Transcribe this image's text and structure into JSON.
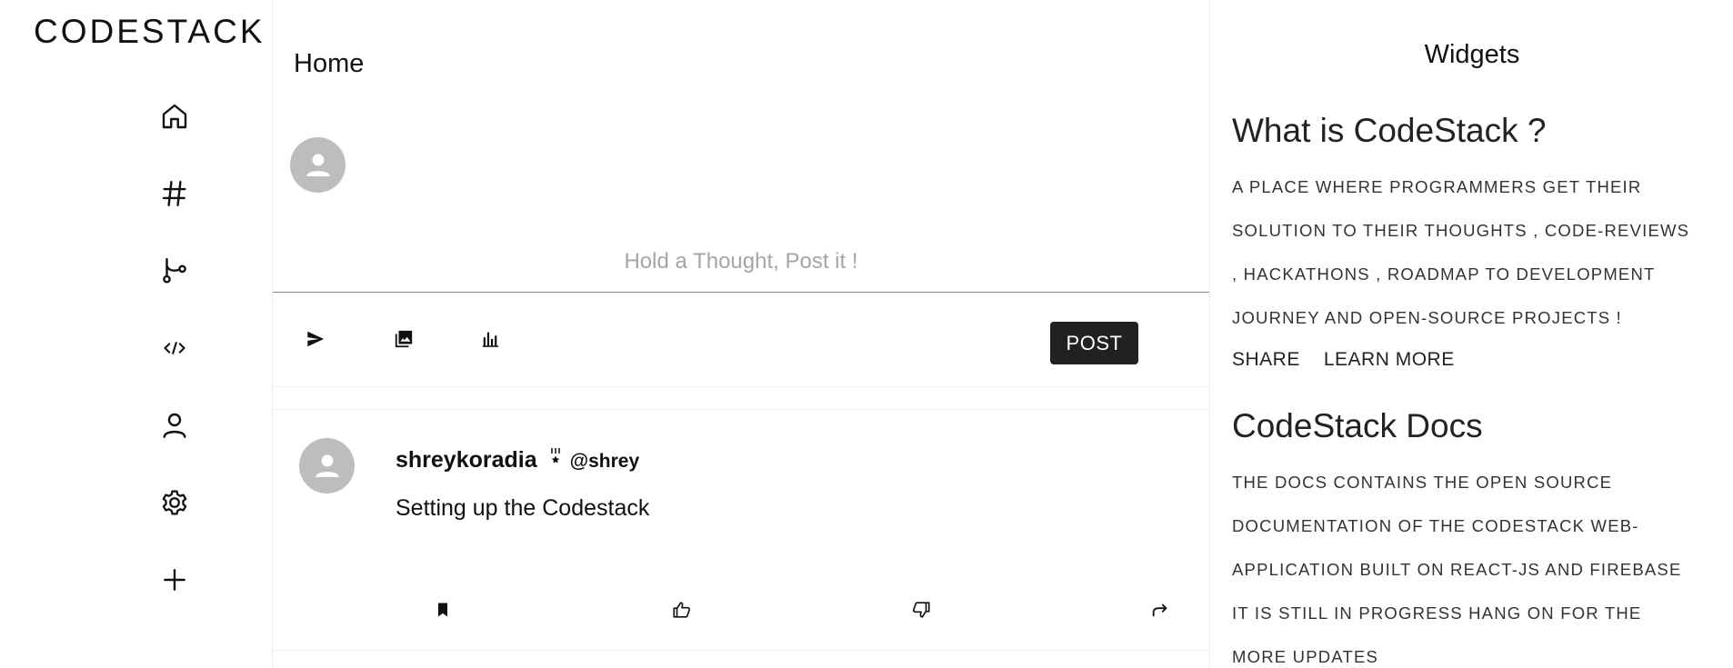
{
  "brand": {
    "name": "CODESTACK"
  },
  "sidebar": {
    "items": [
      {
        "icon": "home-icon",
        "label": "Home"
      },
      {
        "icon": "hashtag-icon",
        "label": "Explore"
      },
      {
        "icon": "git-branch-icon",
        "label": "Projects"
      },
      {
        "icon": "code-icon",
        "label": "Code"
      },
      {
        "icon": "profile-icon",
        "label": "Profile"
      },
      {
        "icon": "settings-icon",
        "label": "Settings"
      },
      {
        "icon": "add-icon",
        "label": "New"
      }
    ]
  },
  "feed": {
    "title": "Home",
    "composer": {
      "placeholder": "Hold a Thought, Post it !",
      "tools": [
        "send-icon",
        "image-icon",
        "poll-icon"
      ],
      "post_label": "POST"
    },
    "posts": [
      {
        "author": "shreykoradia",
        "badge": "medal-icon",
        "handle": "@shrey",
        "text": "Setting up the Codestack",
        "actions": [
          "bookmark-icon",
          "like-icon",
          "dislike-icon",
          "share-icon"
        ]
      }
    ]
  },
  "widgets": {
    "title": "Widgets",
    "cards": [
      {
        "heading": "What is CodeStack ?",
        "lines": [
          "A PLACE WHERE PROGRAMMERS GET THEIR",
          "SOLUTION TO THEIR THOUGHTS , CODE-REVIEWS",
          ", HACKATHONS , ROADMAP TO DEVELOPMENT",
          "JOURNEY AND OPEN-SOURCE PROJECTS !"
        ],
        "actions": [
          "SHARE",
          "LEARN MORE"
        ]
      },
      {
        "heading": "CodeStack Docs",
        "lines": [
          "THE DOCS CONTAINS THE OPEN SOURCE",
          "DOCUMENTATION OF THE CODESTACK WEB-",
          "APPLICATION BUILT ON REACT-JS AND FIREBASE",
          "IT IS STILL IN PROGRESS HANG ON FOR THE",
          "MORE UPDATES"
        ]
      }
    ]
  },
  "colors": {
    "avatar_bg": "#bdbdbd",
    "button_bg": "#212121",
    "placeholder": "#a5a5a5"
  }
}
